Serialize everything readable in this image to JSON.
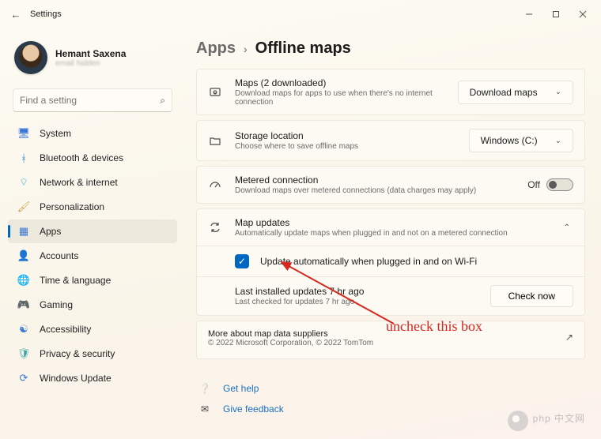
{
  "titlebar": {
    "title": "Settings"
  },
  "user": {
    "name": "Hemant Saxena",
    "sub": "email hidden"
  },
  "search": {
    "placeholder": "Find a setting"
  },
  "sidebar": {
    "items": [
      {
        "label": "System"
      },
      {
        "label": "Bluetooth & devices"
      },
      {
        "label": "Network & internet"
      },
      {
        "label": "Personalization"
      },
      {
        "label": "Apps"
      },
      {
        "label": "Accounts"
      },
      {
        "label": "Time & language"
      },
      {
        "label": "Gaming"
      },
      {
        "label": "Accessibility"
      },
      {
        "label": "Privacy & security"
      },
      {
        "label": "Windows Update"
      }
    ]
  },
  "breadcrumb": {
    "parent": "Apps",
    "title": "Offline maps"
  },
  "cards": {
    "maps": {
      "title": "Maps (2 downloaded)",
      "desc": "Download maps for apps to use when there's no internet connection",
      "button": "Download maps"
    },
    "storage": {
      "title": "Storage location",
      "desc": "Choose where to save offline maps",
      "button": "Windows (C:)"
    },
    "metered": {
      "title": "Metered connection",
      "desc": "Download maps over metered connections (data charges may apply)",
      "toggle_label": "Off"
    },
    "updates": {
      "title": "Map updates",
      "desc": "Automatically update maps when plugged in and not on a metered connection",
      "checkbox_label": "Update automatically when plugged in and on Wi-Fi",
      "last_installed": "Last installed updates 7 hr ago",
      "last_checked": "Last checked for updates 7 hr ago",
      "check_button": "Check now"
    }
  },
  "footer": {
    "about": "More about map data suppliers",
    "copy": "© 2022 Microsoft Corporation, © 2022 TomTom"
  },
  "help": {
    "get_help": "Get help",
    "feedback": "Give feedback"
  },
  "annotation": {
    "text": "uncheck this box"
  },
  "watermark": "php 中文网"
}
